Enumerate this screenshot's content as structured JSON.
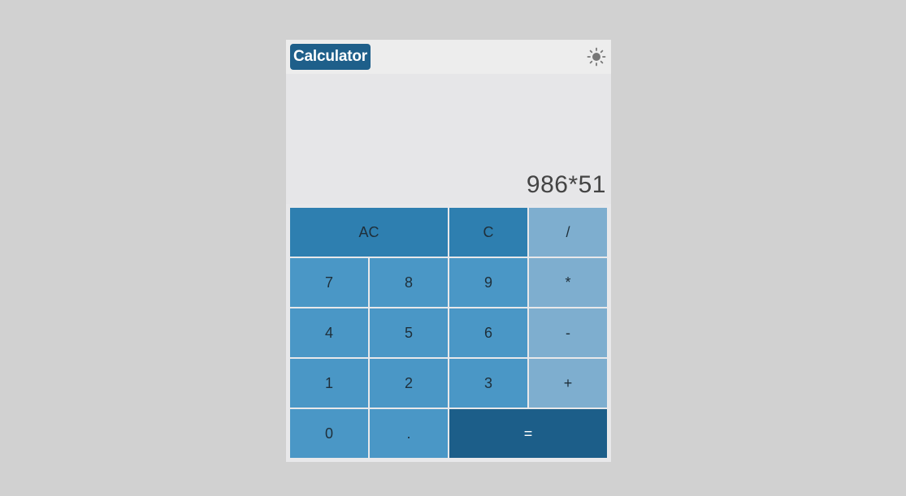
{
  "app": {
    "title": "Calculator",
    "theme_icon": "sun-icon"
  },
  "display": {
    "expression": "986*51"
  },
  "keys": {
    "ac": "AC",
    "c": "C",
    "divide": "/",
    "seven": "7",
    "eight": "8",
    "nine": "9",
    "multiply": "*",
    "four": "4",
    "five": "5",
    "six": "6",
    "subtract": "-",
    "one": "1",
    "two": "2",
    "three": "3",
    "add": "+",
    "zero": "0",
    "decimal": ".",
    "equals": "="
  },
  "colors": {
    "page_background": "#d1d1d1",
    "title_badge": "#1e5f8a",
    "function_key": "#2e7fb0",
    "number_key": "#4a97c6",
    "operator_key": "#7eaecf",
    "equals_key": "#1c5e89"
  }
}
